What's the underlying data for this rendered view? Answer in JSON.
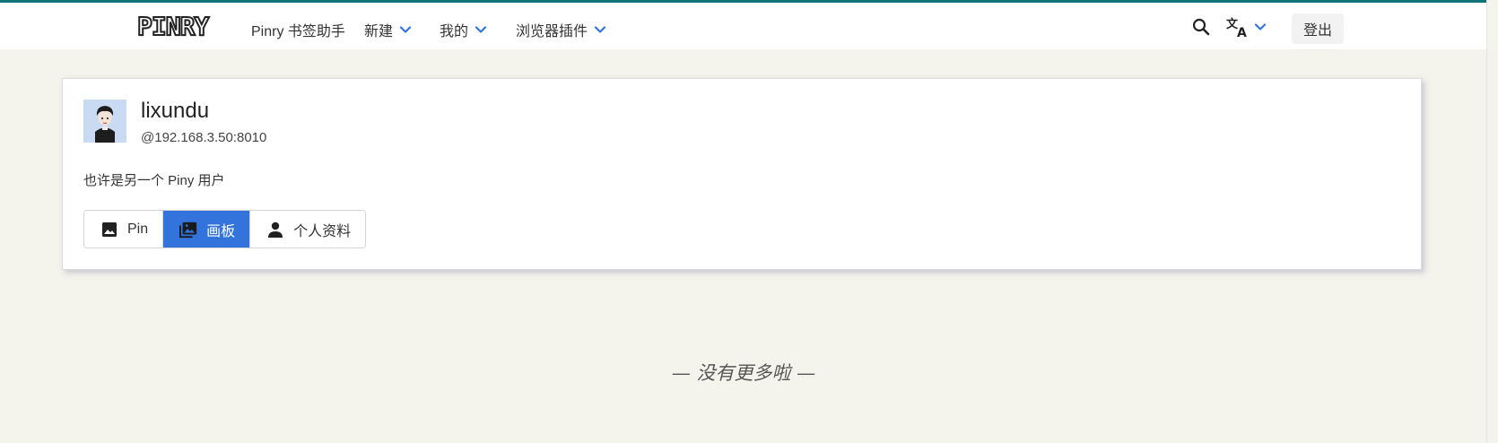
{
  "navbar": {
    "logo": "PINRY",
    "items": [
      {
        "label": "Pinry 书签助手",
        "dropdown": false
      },
      {
        "label": "新建",
        "dropdown": true
      },
      {
        "label": "我的",
        "dropdown": true
      },
      {
        "label": "浏览器插件",
        "dropdown": true
      }
    ],
    "search_icon": "search-icon",
    "language_icon": "translate-icon",
    "logout_label": "登出"
  },
  "profile": {
    "username": "lixundu",
    "handle": "@192.168.3.50:8010",
    "bio": "也许是另一个 Piny 用户",
    "avatar_icon": "avatar"
  },
  "tabs": [
    {
      "label": "Pin",
      "icon": "image-icon",
      "active": false
    },
    {
      "label": "画板",
      "icon": "images-icon",
      "active": true
    },
    {
      "label": "个人资料",
      "icon": "user-icon",
      "active": false
    }
  ],
  "footer": {
    "message": "— 没有更多啦 —"
  },
  "colors": {
    "accent": "#3273dc",
    "topline": "#0e7477",
    "background": "#f4f3ec",
    "chevron": "#3273dc"
  }
}
